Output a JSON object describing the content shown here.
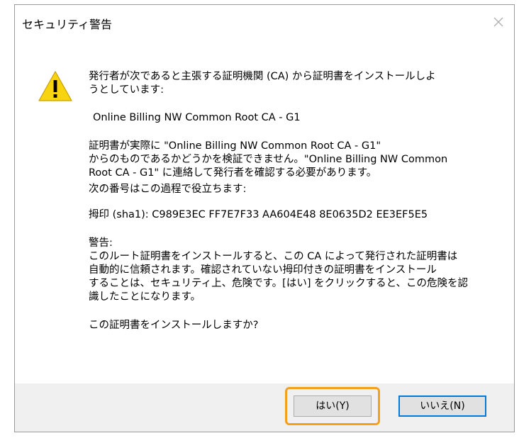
{
  "dialog": {
    "title": "セキュリティ警告",
    "close_icon": "close-icon",
    "warning_icon": "warning-triangle-icon",
    "intro": "発行者が次であると主張する証明機関 (CA) から証明書をインストールしよ\nうとしています:",
    "ca_name": "Online Billing NW Common Root CA - G1",
    "cannot_verify": "証明書が実際に \"Online Billing NW Common Root CA - G1\" \nからのものであるかどうかを検証できません。\"Online Billing NW Common\nRoot CA - G1\" に連絡して発行者を確認する必要があります。",
    "verify_hint": "次の番号はこの過程で役立ちます:",
    "thumbprint": "拇印 (sha1): C989E3EC FF7E7F33 AA604E48 8E0635D2 EE3EF5E5",
    "warning_heading": "警告:",
    "warning_body": "このルート証明書をインストールすると、この CA によって発行された証明書は\n自動的に信頼されます。確認されていない拇印付きの証明書をインストール\nすることは、セキュリティ上、危険です。[はい] をクリックすると、この危険を認\n識したことになります。",
    "question": "この証明書をインストールしますか?",
    "yes_label": "はい(Y)",
    "no_label": "いいえ(N)"
  },
  "colors": {
    "highlight": "#f0a21d",
    "default_button_border": "#0078d7",
    "warning_yellow": "#f8d30f"
  }
}
